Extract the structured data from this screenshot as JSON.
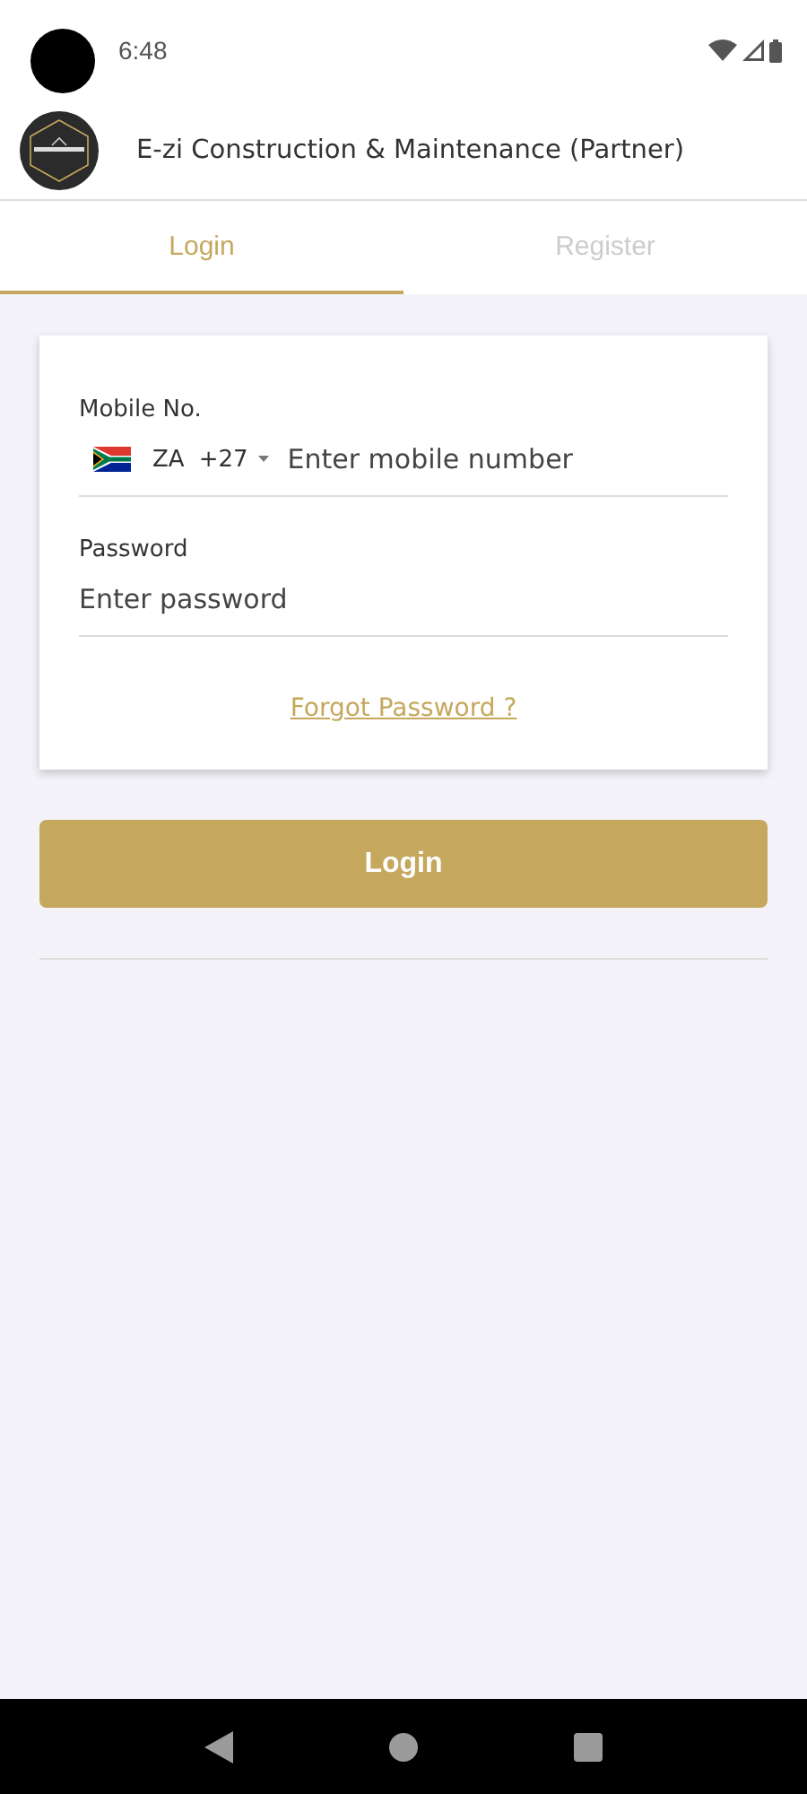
{
  "status_bar": {
    "time": "6:48"
  },
  "header": {
    "title": "E-zi Construction & Maintenance (Partner)"
  },
  "tabs": [
    {
      "label": "Login",
      "selected": true
    },
    {
      "label": "Register",
      "selected": false
    }
  ],
  "form": {
    "mobile": {
      "label": "Mobile No.",
      "country_code": "ZA",
      "dial_code": "+27",
      "placeholder": "Enter mobile number"
    },
    "password": {
      "label": "Password",
      "placeholder": "Enter password"
    },
    "forgot_link": "Forgot Password ?"
  },
  "login_button": "Login"
}
